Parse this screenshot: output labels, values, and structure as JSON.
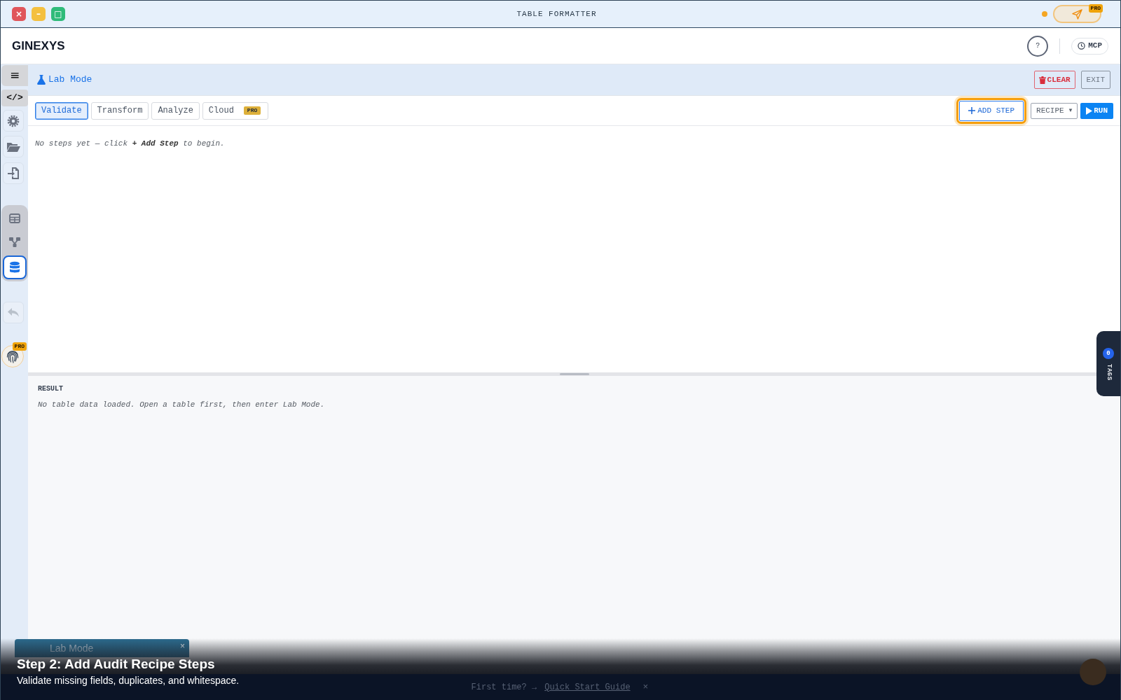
{
  "window": {
    "title": "TABLE FORMATTER",
    "controls": [
      {
        "kind": "close",
        "label": "×"
      },
      {
        "kind": "minimize",
        "label": "–"
      },
      {
        "kind": "maximize",
        "label": "□"
      }
    ],
    "upgrade_badge": "PRO"
  },
  "header": {
    "brand": "GINEXYS",
    "help_label": "?",
    "mcp_label": "MCP"
  },
  "sidebar": {
    "top": [
      {
        "kind": "menu",
        "label": "≡"
      },
      {
        "kind": "code",
        "label": "</>"
      },
      {
        "kind": "settings"
      },
      {
        "kind": "folder"
      },
      {
        "kind": "import"
      }
    ],
    "views": [
      {
        "kind": "table",
        "selected": false
      },
      {
        "kind": "flow",
        "selected": false
      },
      {
        "kind": "database",
        "selected": true
      }
    ],
    "tools": [
      {
        "kind": "undo",
        "disabled": true
      },
      {
        "kind": "fingerprint",
        "disabled": false,
        "badge": "PRO"
      }
    ]
  },
  "lab_bar": {
    "title": "Lab Mode",
    "buttons": [
      {
        "kind": "clear",
        "label": "CLEAR"
      },
      {
        "kind": "exit",
        "label": "EXIT"
      }
    ]
  },
  "tabs": [
    {
      "label": "Validate",
      "selected": true
    },
    {
      "label": "Transform",
      "selected": false
    },
    {
      "label": "Analyze",
      "selected": false
    },
    {
      "label": "Cloud",
      "selected": false,
      "badge": "PRO"
    }
  ],
  "actions": [
    {
      "kind": "add",
      "label": "ADD STEP",
      "focused": true
    },
    {
      "kind": "recipe",
      "label": "RECIPE",
      "caret": "▾",
      "focused": false
    },
    {
      "kind": "run",
      "label": "RUN",
      "focused": false
    }
  ],
  "steps": {
    "empty_message": "No steps yet — click **+ Add Step** to begin."
  },
  "result": {
    "heading": "RESULT",
    "message": "No table data loaded. Open a table first, then enter Lab Mode."
  },
  "tags_panel": {
    "label": "TAGS",
    "count": "0"
  },
  "toast": {
    "title": "Lab Mode",
    "close": "×"
  },
  "footer": {
    "prompt": "First time? →",
    "link": "Quick Start Guide",
    "close": "×"
  },
  "caption": {
    "title": "Step 2: Add Audit Recipe Steps",
    "text": "Validate missing fields, duplicates, and whitespace."
  }
}
